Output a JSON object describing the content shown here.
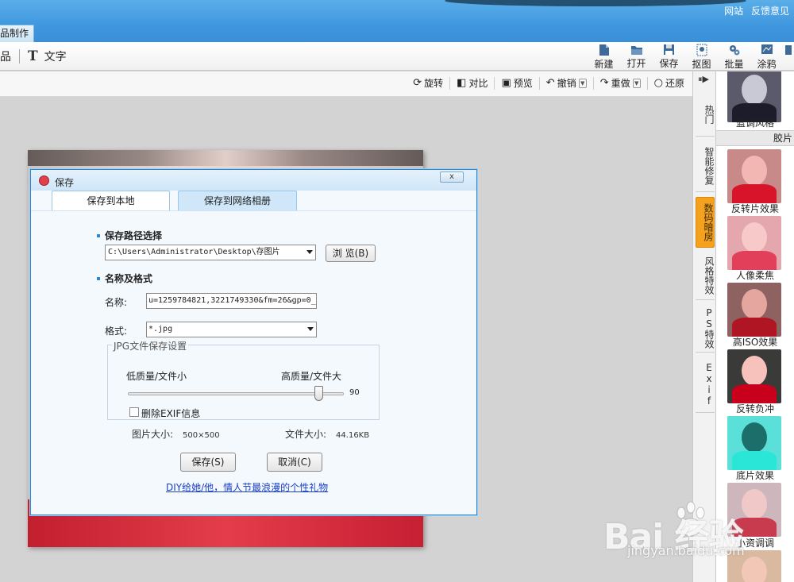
{
  "top_links": [
    "网站",
    "反馈意见"
  ],
  "app_tab": "品制作",
  "toolbar_left": {
    "item_label": "品",
    "text_label": "文字"
  },
  "toolbar_right": [
    {
      "name": "new",
      "label": "新建",
      "icon": "new-file-icon"
    },
    {
      "name": "open",
      "label": "打开",
      "icon": "folder-icon"
    },
    {
      "name": "save",
      "label": "保存",
      "icon": "floppy-icon"
    },
    {
      "name": "cutout",
      "label": "抠图",
      "icon": "cutout-icon"
    },
    {
      "name": "batch",
      "label": "批量",
      "icon": "gears-icon"
    },
    {
      "name": "doodle",
      "label": "涂鸦",
      "icon": "paint-icon"
    }
  ],
  "edit_toolbar": [
    {
      "name": "rotate",
      "label": "旋转",
      "glyph": "⟳"
    },
    {
      "name": "compare",
      "label": "对比",
      "glyph": "◧"
    },
    {
      "name": "preview",
      "label": "预览",
      "glyph": "▣"
    },
    {
      "name": "undo",
      "label": "撤销",
      "glyph": "↶"
    },
    {
      "name": "redo",
      "label": "重做",
      "glyph": "↷"
    },
    {
      "name": "restore",
      "label": "还原",
      "glyph": "○"
    }
  ],
  "side_tabs": [
    "热门",
    "智能修复",
    "数码暗房",
    "风格特效",
    "PS特效",
    "Exif"
  ],
  "active_side_tab": "数码暗房",
  "thumb_category": "胶片",
  "thumbs": [
    {
      "label": "蓝调风格",
      "face": "#c9c9d6",
      "body": "#1c1c2a",
      "bg": "#5a5a6a"
    },
    {
      "label": "反转片效果",
      "face": "#f2b7b2",
      "body": "#d8142a",
      "bg": "#c88a88"
    },
    {
      "label": "人像柔焦",
      "face": "#f7c9c9",
      "body": "#e2405a",
      "bg": "#e3a7ad"
    },
    {
      "label": "高ISO效果",
      "face": "#e6a6a0",
      "body": "#b01524",
      "bg": "#8e6260"
    },
    {
      "label": "反转负冲",
      "face": "#f6c2bb",
      "body": "#c8001c",
      "bg": "#3a3a38"
    },
    {
      "label": "底片效果",
      "face": "#1c6e6a",
      "body": "#2ae6d6",
      "bg": "#5ae0d8"
    },
    {
      "label": "小资调调",
      "face": "#f1c8c8",
      "body": "#c83a4e",
      "bg": "#cdb7bd"
    }
  ],
  "dialog": {
    "title": "保存",
    "close": "x",
    "tabs": [
      "保存到本地",
      "保存到网络相册"
    ],
    "path_section": "保存路径选择",
    "path_value": "C:\\Users\\Administrator\\Desktop\\存图片",
    "browse_button": "浏 览(B)",
    "name_section": "名称及格式",
    "name_label": "名称:",
    "name_value": "u=1259784821,3221749330&fm=26&gp=0_",
    "format_label": "格式:",
    "format_value": "*.jpg",
    "jpg_group": "JPG文件保存设置",
    "low_quality": "低质量/文件小",
    "high_quality": "高质量/文件大",
    "quality_value": "90",
    "quality_fraction": 0.9,
    "remove_exif": "删除EXIF信息",
    "image_size_label": "图片大小:",
    "image_size_value": "500×500",
    "file_size_label": "文件大小:",
    "file_size_value": "44.16KB",
    "save_button": "保存(S)",
    "cancel_button": "取消(C)",
    "promo_link": "DIY给她/他，情人节最浪漫的个性礼物"
  },
  "watermark": {
    "brand": "Bai 经验",
    "url": "jingyan.baidu.com"
  }
}
